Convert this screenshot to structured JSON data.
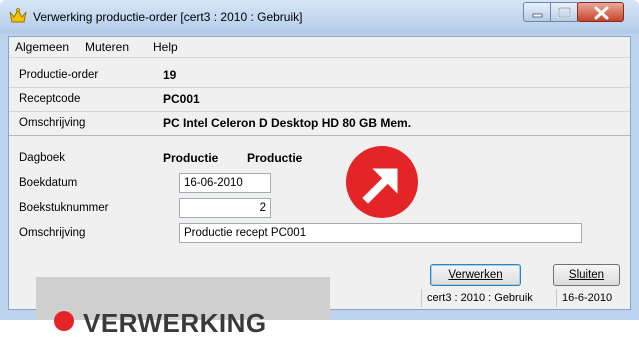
{
  "window": {
    "title": "Verwerking productie-order  [cert3 : 2010 : Gebruik]",
    "icon": "crown-icon"
  },
  "menu": {
    "items": [
      {
        "label": "Algemeen"
      },
      {
        "label": "Muteren"
      },
      {
        "label": "Help"
      }
    ]
  },
  "info": {
    "productie_order_label": "Productie-order",
    "productie_order_value": "19",
    "receptcode_label": "Receptcode",
    "receptcode_value": "PC001",
    "omschrijving_label": "Omschrijving",
    "omschrijving_value": "PC Intel Celeron D Desktop HD 80 GB Mem."
  },
  "form": {
    "dagboek_label": "Dagboek",
    "dagboek_code": "Productie",
    "dagboek_name": "Productie",
    "boekdatum_label": "Boekdatum",
    "boekdatum_value": "16-06-2010",
    "boekstuknummer_label": "Boekstuknummer",
    "boekstuknummer_value": "2",
    "omschrijving_label": "Omschrijving",
    "omschrijving_value": "Productie recept PC001"
  },
  "buttons": {
    "verwerken": "Verwerken",
    "sluiten": "Sluiten"
  },
  "status": {
    "context": "cert3 : 2010 : Gebruik",
    "date": "16-6-2010"
  },
  "overlay": {
    "caption": "VERWERKING",
    "badge_color": "#e42528"
  }
}
